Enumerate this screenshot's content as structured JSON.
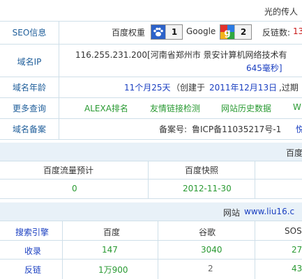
{
  "header": {
    "title": "光的传人"
  },
  "rows": {
    "seo": {
      "label": "SEO信息",
      "baidu_weight_label": "百度权重",
      "baidu_weight_value": "1",
      "google_label": "Google",
      "google_value": "2",
      "backlinks_label": "反链数:",
      "backlinks_value": "13"
    },
    "ip": {
      "label": "域名IP",
      "line1": "116.255.231.200[河南省郑州市 景安计算机网络技术有",
      "line2": "645毫秒]"
    },
    "age": {
      "label": "域名年龄",
      "age_value": "11个月25天",
      "created_prefix": "（创建于",
      "created_date": "2011年12月13日",
      "created_suffix": ",过期"
    },
    "more": {
      "label": "更多查询",
      "links": [
        "ALEXA排名",
        "友情链接检测",
        "网站历史数据",
        "W"
      ]
    },
    "icp": {
      "label": "域名备案",
      "prefix": "备案号:",
      "value": "鲁ICP备11035217号-1",
      "tail": "悦"
    }
  },
  "baidu_section": {
    "title": "百度",
    "col1_header": "百度流量预计",
    "col2_header": "百度快照",
    "traffic": "0",
    "snapshot": "2012-11-30"
  },
  "site_section": {
    "title_prefix": "网站",
    "site_url": "www.liu16.c",
    "headers": [
      "搜索引擎",
      "百度",
      "谷歌",
      "SOS"
    ],
    "rows": [
      {
        "label": "收录",
        "values": [
          "147",
          "3040",
          "27"
        ]
      },
      {
        "label": "反链",
        "values": [
          "1万900",
          "2",
          "43"
        ]
      }
    ]
  },
  "colors": {
    "label_blue": "#1f5e9a",
    "link_blue": "#1a3fc1",
    "green": "#2a9a33",
    "red": "#c81818",
    "band": "#e8f1f8",
    "border": "#cfdfe9"
  },
  "icons": {
    "baidu": "paw-icon",
    "google": "google-g-icon"
  }
}
